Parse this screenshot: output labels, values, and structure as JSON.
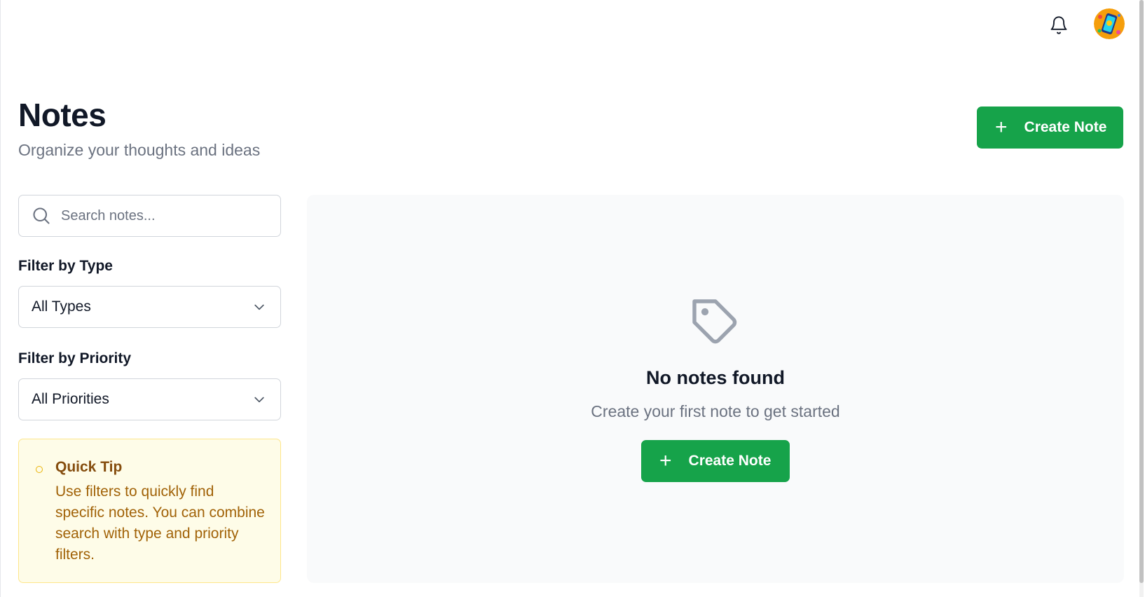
{
  "topbar": {
    "notifications_icon": "bell-icon",
    "avatar_icon": "user-avatar"
  },
  "header": {
    "title": "Notes",
    "subtitle": "Organize your thoughts and ideas",
    "create_label": "Create Note"
  },
  "sidebar": {
    "search": {
      "placeholder": "Search notes...",
      "value": ""
    },
    "type_filter": {
      "label": "Filter by Type",
      "selected": "All Types"
    },
    "priority_filter": {
      "label": "Filter by Priority",
      "selected": "All Priorities"
    },
    "tip": {
      "title": "Quick Tip",
      "text": "Use filters to quickly find specific notes. You can combine search with type and priority filters."
    }
  },
  "main": {
    "empty_icon": "tag-icon",
    "empty_title": "No notes found",
    "empty_subtitle": "Create your first note to get started",
    "create_label": "Create Note"
  },
  "colors": {
    "primary": "#16a34a",
    "tip_bg": "#fefce8",
    "tip_border": "#fde68a",
    "tip_title": "#854d0e",
    "tip_text": "#a16207"
  }
}
